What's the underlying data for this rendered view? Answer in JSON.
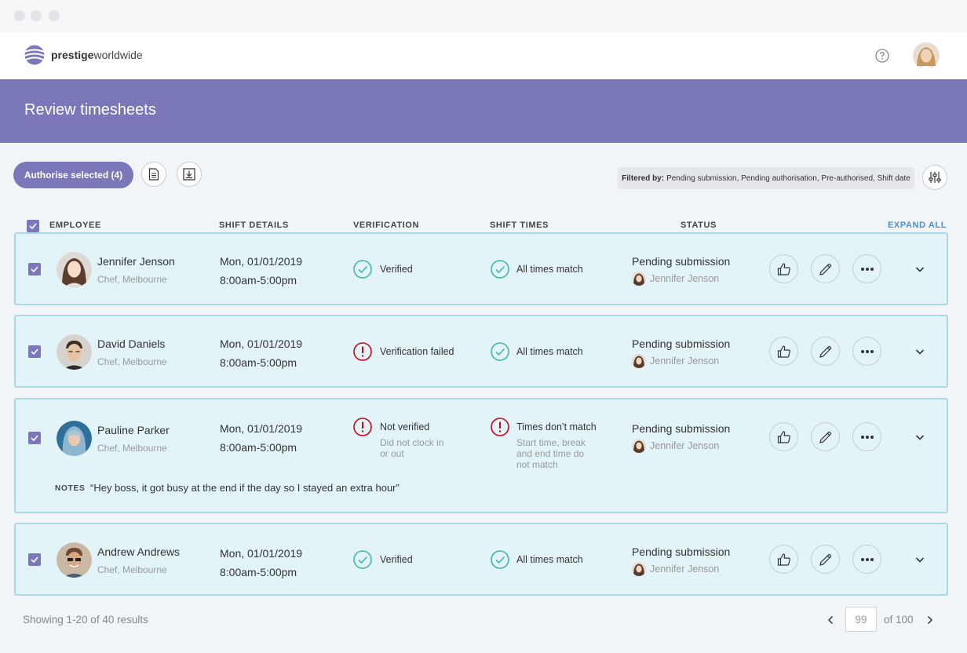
{
  "window": {
    "title": ""
  },
  "brand": {
    "name_bold": "prestige",
    "name_regular": "worldwide",
    "accent": "#7b78ba"
  },
  "header": {
    "help_icon": "question-circle-icon",
    "user_avatar": "user-avatar"
  },
  "page": {
    "title": "Review timesheets"
  },
  "toolbar": {
    "authorise_label": "Authorise selected (4)",
    "report_icon": "document-icon",
    "download_icon": "download-icon",
    "filter_prefix": "Filtered by:",
    "filter_values": "Pending submission, Pending authorisation, Pre-authorised, Shift date",
    "settings_icon": "sliders-icon"
  },
  "table": {
    "headers": {
      "employee": "EMPLOYEE",
      "shift": "SHIFT DETAILS",
      "verification": "VERIFICATION",
      "times": "SHIFT TIMES",
      "status": "STATUS",
      "expand_all": "EXPAND ALL"
    },
    "rows": [
      {
        "name": "Jennifer Jenson",
        "role": "Chef, Melbourne",
        "date": "Mon, 01/01/2019",
        "time": "8:00am-5:00pm",
        "verification": "Verified",
        "verification_status": "ok",
        "times": "All times match",
        "times_status": "ok",
        "status": "Pending submission",
        "status_person": "Jennifer Jenson"
      },
      {
        "name": "David Daniels",
        "role": "Chef, Melbourne",
        "date": "Mon, 01/01/2019",
        "time": "8:00am-5:00pm",
        "verification": "Verification failed",
        "verification_status": "error",
        "times": "All times match",
        "times_status": "ok",
        "status": "Pending submission",
        "status_person": "Jennifer Jenson"
      },
      {
        "name": "Pauline Parker",
        "role": "Chef, Melbourne",
        "date": "Mon, 01/01/2019",
        "time": "8:00am-5:00pm",
        "verification": "Not verified",
        "verification_status": "error",
        "verification_sub": [
          "Did not clock in",
          "or out"
        ],
        "times": "Times don’t match",
        "times_status": "error",
        "times_sub": [
          "Start time, break",
          "and end time do",
          "not match"
        ],
        "status": "Pending submission",
        "status_person": "Jennifer Jenson",
        "notes_label": "NOTES",
        "notes": "“Hey boss, it got busy at the end if the day so I stayed an extra hour”"
      },
      {
        "name": "Andrew Andrews",
        "role": "Chef, Melbourne",
        "date": "Mon, 01/01/2019",
        "time": "8:00am-5:00pm",
        "verification": "Verified",
        "verification_status": "ok",
        "times": "All times match",
        "times_status": "ok",
        "status": "Pending submission",
        "status_person": "Jennifer Jenson"
      }
    ]
  },
  "footer": {
    "results": "Showing 1-20 of 40 results",
    "page": "99",
    "of": "of 100"
  },
  "colors": {
    "ok": "#3fb7a6",
    "error": "#d0021b",
    "row_bg": "#e2f4f7",
    "row_border": "#aad8e6",
    "banner": "#7b78ba",
    "link": "#4a8fd3"
  }
}
